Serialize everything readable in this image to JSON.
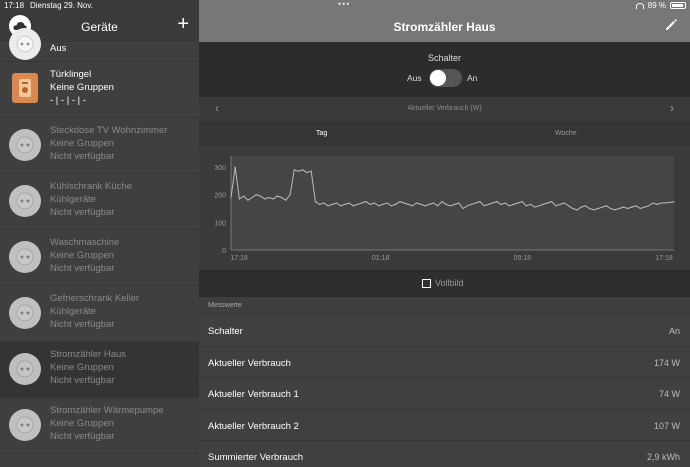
{
  "statusbar": {
    "time": "17:18",
    "date": "Dienstag 29. Nov.",
    "battery": "89 %",
    "dots": "•••"
  },
  "sidebar": {
    "title": "Geräte",
    "add_icon": "plus-icon",
    "logo_icon": "cloud-logo-icon",
    "items": [
      {
        "name": "",
        "group": "Aus",
        "status": "",
        "icon": "device-icon",
        "dim": false,
        "first": true
      },
      {
        "name": "Türklingel",
        "group": "Keine Gruppen",
        "status": "- | - | - | -",
        "icon": "doorbell-icon",
        "dim": false
      },
      {
        "name": "Steckdose TV Wohnzimmer",
        "group": "Keine Gruppen",
        "status": "Nicht verfügbar",
        "icon": "socket-icon",
        "dim": true
      },
      {
        "name": "Kühlschrank Küche",
        "group": "Kühlgeräte",
        "status": "Nicht verfügbar",
        "icon": "socket-icon",
        "dim": true
      },
      {
        "name": "Waschmaschine",
        "group": "Keine Gruppen",
        "status": "Nicht verfügbar",
        "icon": "socket-icon",
        "dim": true
      },
      {
        "name": "Gefrierschrank Keller",
        "group": "Kühlgeräte",
        "status": "Nicht verfügbar",
        "icon": "socket-icon",
        "dim": true
      },
      {
        "name": "Stromzähler Haus",
        "group": "Keine Gruppen",
        "status": "Nicht verfügbar",
        "icon": "socket-icon",
        "dim": true,
        "selected": true
      },
      {
        "name": "Stromzähler Wärmepumpe",
        "group": "Keine Gruppen",
        "status": "Nicht verfügbar",
        "icon": "socket-icon",
        "dim": true
      }
    ]
  },
  "main": {
    "title": "Stromzähler Haus",
    "edit_icon": "pencil-icon",
    "switch": {
      "label": "Schalter",
      "off_label": "Aus",
      "on_label": "An",
      "state": "off"
    },
    "chart_nav": {
      "label": "Aktueller Verbrauch (W)",
      "prev_icon": "chevron-left-icon",
      "next_icon": "chevron-right-icon"
    },
    "tabs": [
      "Tag",
      "Woche"
    ],
    "fullscreen_label": "Vollbild",
    "section_label": "Messwerte",
    "rows": [
      {
        "label": "Schalter",
        "value": "An"
      },
      {
        "label": "Aktueller Verbrauch",
        "value": "174 W"
      },
      {
        "label": "Aktueller Verbrauch 1",
        "value": "74 W"
      },
      {
        "label": "Aktueller Verbrauch 2",
        "value": "107 W"
      },
      {
        "label": "Summierter Verbrauch",
        "value": "2,9 kWh"
      }
    ]
  },
  "chart_data": {
    "type": "line",
    "title": "",
    "xlabel": "",
    "ylabel": "",
    "y_ticks": [
      0,
      100,
      200,
      300
    ],
    "x_ticks": [
      "17:18",
      "01:18",
      "09:18",
      "17:18"
    ],
    "ylim": [
      0,
      340
    ],
    "grid": false,
    "series": [
      {
        "values": [
          190,
          300,
          185,
          195,
          180,
          190,
          200,
          195,
          185,
          190,
          185,
          195,
          190,
          180,
          200,
          290,
          285,
          290,
          280,
          285,
          175,
          165,
          170,
          160,
          165,
          170,
          160,
          165,
          170,
          160,
          165,
          170,
          175,
          165,
          170,
          160,
          165,
          170,
          160,
          165,
          175,
          170,
          165,
          160,
          170,
          165,
          160,
          165,
          170,
          160,
          175,
          165,
          160,
          165,
          170,
          150,
          160,
          165,
          170,
          175,
          160,
          165,
          170,
          175,
          165,
          170,
          160,
          165,
          170,
          175,
          160,
          165,
          155,
          160,
          165,
          170,
          175,
          160,
          165,
          170,
          160,
          150,
          145,
          155,
          160,
          150,
          145,
          150,
          155,
          160,
          150,
          145,
          150,
          155,
          150,
          155,
          160,
          150,
          155,
          160,
          170,
          165,
          170,
          170,
          172,
          174
        ]
      }
    ],
    "line_color": "#bbbbbb"
  }
}
